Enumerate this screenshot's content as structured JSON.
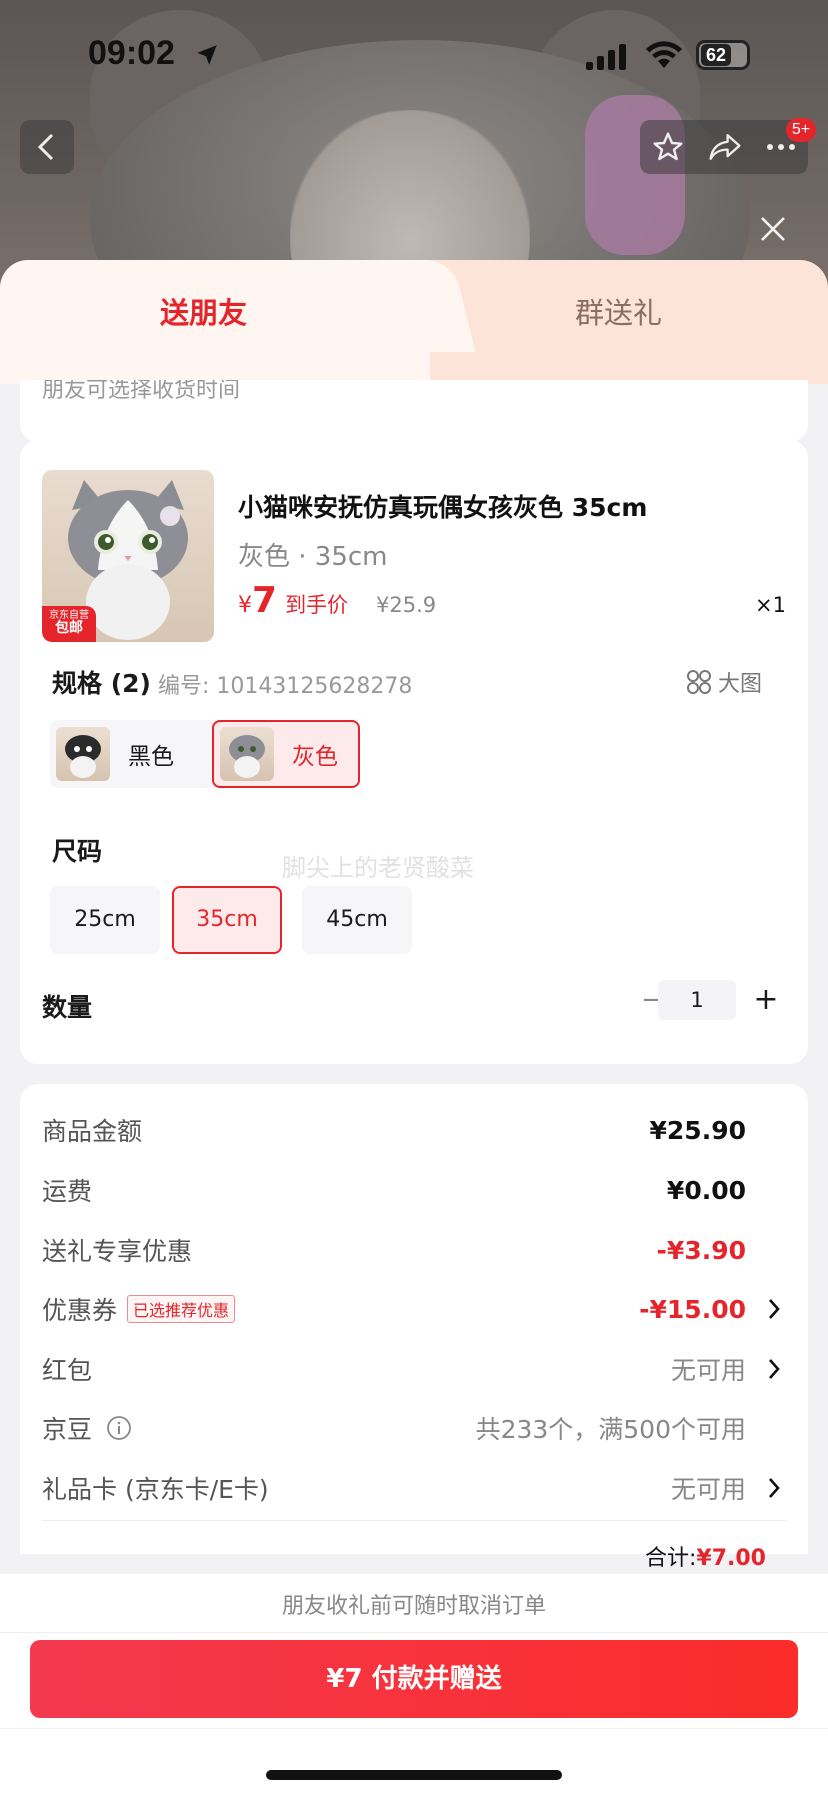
{
  "status": {
    "time": "09:02",
    "battery": "62"
  },
  "nav": {
    "badge": "5+"
  },
  "tabs": [
    {
      "label": "送朋友"
    },
    {
      "label": "群送礼"
    }
  ],
  "cut_text": "朋友可选择收货时间",
  "product": {
    "title": "小猫咪安抚仿真玩偶女孩灰色 35cm",
    "spec": "灰色 · 35cm",
    "price_symbol": "¥",
    "price": "7",
    "price_label": "到手价",
    "original_price": "¥25.9",
    "quantity": "×1",
    "tag_top": "京东自营",
    "tag_bottom": "包邮"
  },
  "spec_section": {
    "title": "规格 (2)",
    "code": "编号: 10143125628278",
    "big_image": "大图",
    "colors": [
      {
        "label": "黑色"
      },
      {
        "label": "灰色"
      }
    ]
  },
  "size_section": {
    "title": "尺码",
    "watermark": "脚尖上的老贤酸菜",
    "sizes": [
      {
        "label": "25cm"
      },
      {
        "label": "35cm"
      },
      {
        "label": "45cm"
      }
    ]
  },
  "quantity_section": {
    "title": "数量",
    "minus": "−",
    "value": "1",
    "plus": "+"
  },
  "cost": {
    "rows": [
      {
        "label": "商品金额",
        "value": "¥25.90"
      },
      {
        "label": "运费",
        "value": "¥0.00"
      },
      {
        "label": "送礼专享优惠",
        "value": "-¥3.90"
      },
      {
        "label": "优惠券",
        "tag": "已选推荐优惠",
        "value": "-¥15.00"
      },
      {
        "label": "红包",
        "value": "无可用"
      },
      {
        "label": "京豆",
        "value": "共233个，满500个可用"
      },
      {
        "label": "礼品卡 (京东卡/E卡)",
        "value": "无可用"
      }
    ],
    "total_label": "合计:",
    "total_value": "¥7.00"
  },
  "footer": {
    "note": "朋友收礼前可随时取消订单",
    "pay_button": "¥7 付款并赠送"
  },
  "colors": {
    "accent": "#e4262c",
    "tab_bg": "#fde4d9"
  }
}
